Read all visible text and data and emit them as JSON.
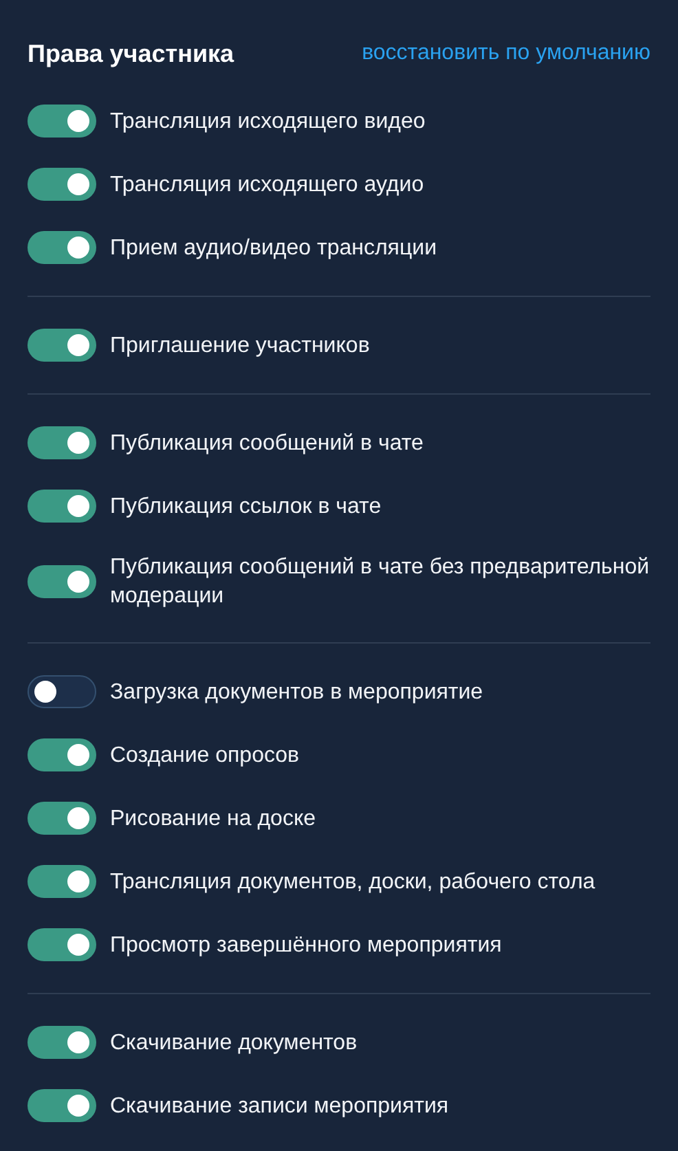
{
  "header": {
    "title": "Права участника",
    "reset_link": "восстановить по умолчанию"
  },
  "groups": [
    {
      "items": [
        {
          "label": "Трансляция исходящего видео",
          "on": true
        },
        {
          "label": "Трансляция исходящего аудио",
          "on": true
        },
        {
          "label": "Прием аудио/видео трансляции",
          "on": true
        }
      ]
    },
    {
      "items": [
        {
          "label": "Приглашение участников",
          "on": true
        }
      ]
    },
    {
      "items": [
        {
          "label": "Публикация сообщений в чате",
          "on": true
        },
        {
          "label": "Публикация ссылок в чате",
          "on": true
        },
        {
          "label": "Публикация сообщений в чате без предварительной модерации",
          "on": true
        }
      ]
    },
    {
      "items": [
        {
          "label": "Загрузка документов в мероприятие",
          "on": false
        },
        {
          "label": "Создание опросов",
          "on": true
        },
        {
          "label": "Рисование на доске",
          "on": true
        },
        {
          "label": "Трансляция документов, доски, рабочего стола",
          "on": true
        },
        {
          "label": "Просмотр завершённого мероприятия",
          "on": true
        }
      ]
    },
    {
      "items": [
        {
          "label": "Скачивание документов",
          "on": true
        },
        {
          "label": "Скачивание записи мероприятия",
          "on": true
        }
      ]
    }
  ]
}
